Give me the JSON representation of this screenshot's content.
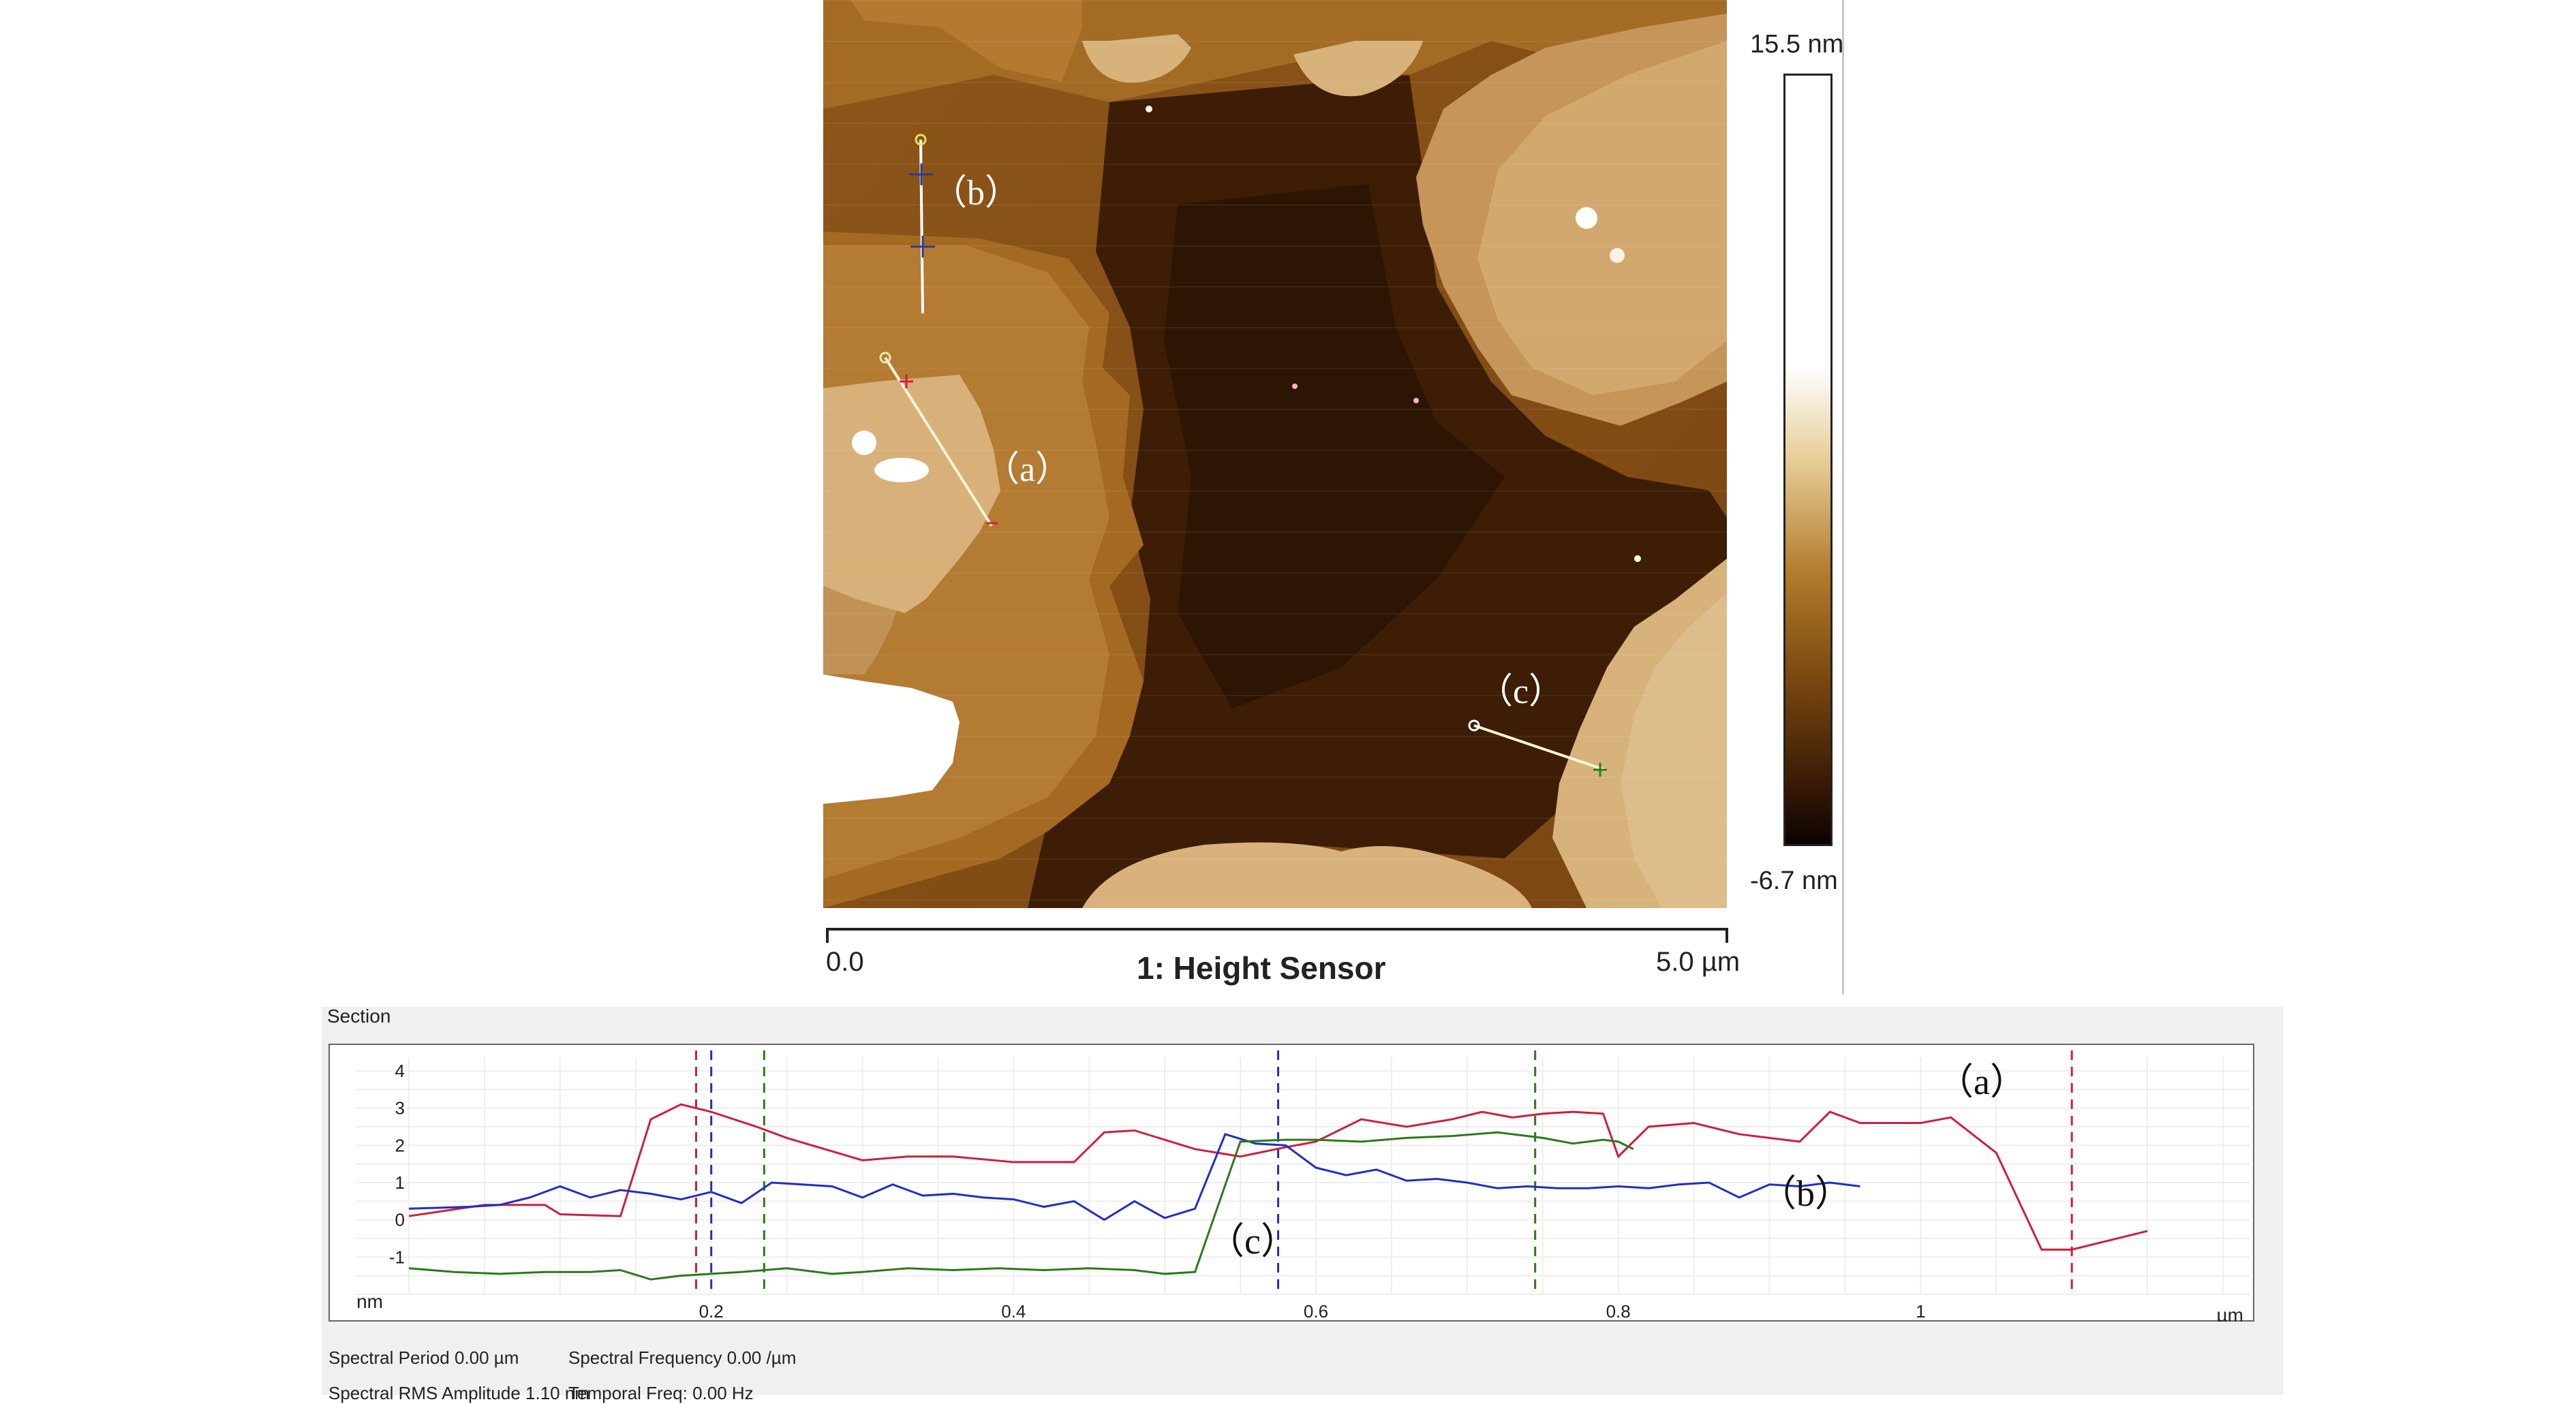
{
  "image_panel": {
    "colorbar": {
      "max_label": "15.5 nm",
      "min_label": "-6.7 nm"
    },
    "scale_bar": {
      "start_label": "0.0",
      "end_label": "5.0 µm",
      "title": "1: Height Sensor"
    },
    "markers": {
      "a": "（a）",
      "b": "（b）",
      "c": "（c）"
    },
    "colors": {
      "low": "#1e0c02",
      "mid": "#8a5418",
      "high": "#ffffff"
    }
  },
  "section": {
    "title": "Section",
    "stats": {
      "spectral_period": "Spectral Period 0.00 µm",
      "spectral_frequency": "Spectral Frequency 0.00 /µm",
      "rms_amplitude": "Spectral RMS Amplitude 1.10 nm",
      "temporal_freq": "Temporal Freq: 0.00 Hz"
    }
  },
  "chart_data": {
    "type": "line",
    "xlabel": "µm",
    "ylabel": "nm",
    "xlim": [
      0,
      1.2
    ],
    "ylim": [
      -2,
      4
    ],
    "x_ticks": [
      0.2,
      0.4,
      0.6,
      0.8,
      1
    ],
    "x_tick_labels": [
      "0.2",
      "0.4",
      "0.6",
      "0.8",
      "1"
    ],
    "y_ticks": [
      4,
      3,
      2,
      1,
      0,
      -1
    ],
    "y_tick_labels": [
      "4",
      "3",
      "2",
      "1",
      "0",
      "-1"
    ],
    "grid": true,
    "series": [
      {
        "name": "（a）",
        "color": "#d01f3c",
        "x": [
          0,
          0.05,
          0.09,
          0.1,
          0.14,
          0.16,
          0.18,
          0.2,
          0.23,
          0.25,
          0.3,
          0.33,
          0.36,
          0.4,
          0.42,
          0.44,
          0.46,
          0.48,
          0.52,
          0.55,
          0.58,
          0.6,
          0.63,
          0.66,
          0.69,
          0.71,
          0.73,
          0.75,
          0.77,
          0.79,
          0.8,
          0.82,
          0.85,
          0.88,
          0.92,
          0.94,
          0.96,
          0.98,
          1.0,
          1.02,
          1.05,
          1.08,
          1.1,
          1.12,
          1.15
        ],
        "y": [
          0.1,
          0.4,
          0.4,
          0.15,
          0.1,
          2.7,
          3.1,
          2.9,
          2.5,
          2.2,
          1.6,
          1.7,
          1.7,
          1.55,
          1.55,
          1.55,
          2.35,
          2.4,
          1.9,
          1.7,
          1.95,
          2.1,
          2.7,
          2.5,
          2.7,
          2.9,
          2.75,
          2.85,
          2.9,
          2.85,
          1.7,
          2.5,
          2.6,
          2.3,
          2.1,
          2.9,
          2.6,
          2.6,
          2.6,
          2.75,
          1.8,
          -0.8,
          -0.8,
          -0.6,
          -0.3
        ]
      },
      {
        "name": "（b）",
        "color": "#1f2fc8",
        "x": [
          0,
          0.04,
          0.06,
          0.08,
          0.1,
          0.12,
          0.14,
          0.16,
          0.18,
          0.2,
          0.22,
          0.24,
          0.26,
          0.28,
          0.3,
          0.32,
          0.34,
          0.36,
          0.38,
          0.4,
          0.42,
          0.44,
          0.46,
          0.48,
          0.5,
          0.52,
          0.54,
          0.56,
          0.58,
          0.6,
          0.62,
          0.64,
          0.66,
          0.68,
          0.7,
          0.72,
          0.74,
          0.76,
          0.78,
          0.8,
          0.82,
          0.84,
          0.86,
          0.88,
          0.9,
          0.92,
          0.94,
          0.96
        ],
        "y": [
          0.3,
          0.35,
          0.4,
          0.6,
          0.9,
          0.6,
          0.8,
          0.7,
          0.55,
          0.75,
          0.45,
          1.0,
          0.95,
          0.9,
          0.6,
          0.95,
          0.65,
          0.7,
          0.6,
          0.55,
          0.35,
          0.5,
          0.0,
          0.5,
          0.05,
          0.3,
          2.3,
          2.05,
          2.0,
          1.4,
          1.2,
          1.35,
          1.05,
          1.1,
          1.0,
          0.85,
          0.9,
          0.85,
          0.85,
          0.9,
          0.85,
          0.95,
          1.0,
          0.6,
          0.95,
          0.9,
          1.0,
          0.9
        ]
      },
      {
        "name": "（c）",
        "color": "#2c7a1c",
        "x": [
          0,
          0.03,
          0.06,
          0.09,
          0.12,
          0.14,
          0.16,
          0.18,
          0.2,
          0.22,
          0.25,
          0.28,
          0.3,
          0.33,
          0.36,
          0.39,
          0.42,
          0.45,
          0.48,
          0.5,
          0.52,
          0.55,
          0.58,
          0.6,
          0.63,
          0.66,
          0.69,
          0.72,
          0.75,
          0.77,
          0.79,
          0.8,
          0.81
        ],
        "y": [
          -1.3,
          -1.4,
          -1.45,
          -1.4,
          -1.4,
          -1.35,
          -1.6,
          -1.5,
          -1.45,
          -1.4,
          -1.3,
          -1.45,
          -1.4,
          -1.3,
          -1.35,
          -1.3,
          -1.35,
          -1.3,
          -1.35,
          -1.45,
          -1.4,
          2.1,
          2.15,
          2.15,
          2.1,
          2.2,
          2.25,
          2.35,
          2.2,
          2.05,
          2.15,
          2.1,
          1.9
        ]
      }
    ],
    "cursors": [
      {
        "x": 0.19,
        "color": "#d01f3c"
      },
      {
        "x": 0.2,
        "color": "#1f2fc8"
      },
      {
        "x": 0.235,
        "color": "#2c7a1c"
      },
      {
        "x": 0.575,
        "color": "#1f2fc8"
      },
      {
        "x": 0.745,
        "color": "#2c7a1c"
      },
      {
        "x": 1.1,
        "color": "#d01f3c"
      }
    ]
  }
}
